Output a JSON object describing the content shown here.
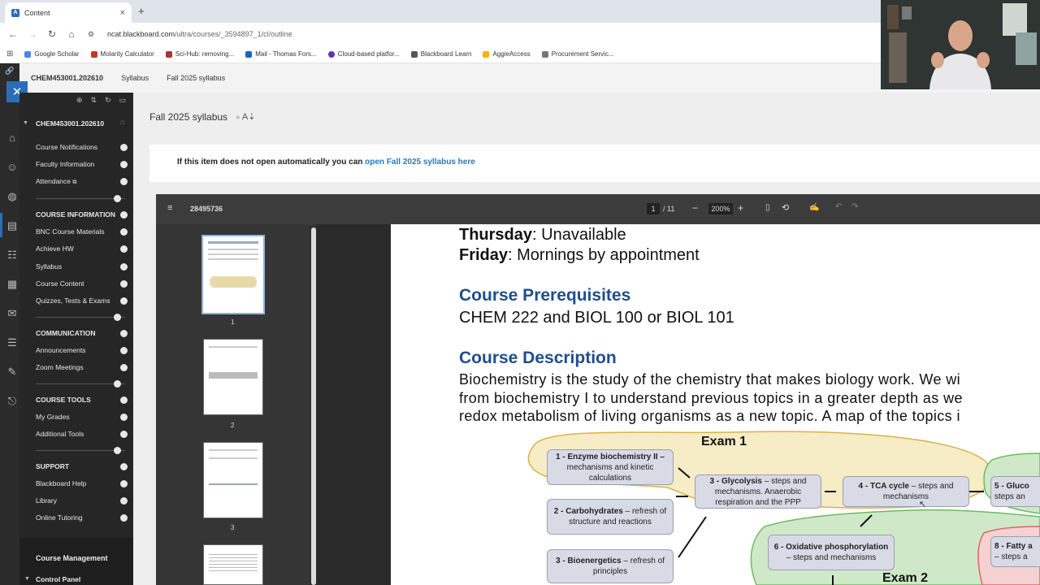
{
  "browser": {
    "tab_title": "Content",
    "tab_close": "×",
    "new_tab": "+",
    "url_host": "ncat.blackboard.com",
    "url_path": "/ultra/courses/_3594897_1/cl/outline",
    "bookmarks": [
      "Google Scholar",
      "Molarity Calculator",
      "Sci-Hub: removing...",
      "Mail - Thomas Fors...",
      "Cloud-based platfor...",
      "Blackboard Learn",
      "AggieAccess",
      "Procurement Servic..."
    ]
  },
  "header": {
    "course_id": "CHEM453001.202610",
    "crumbs": [
      "Syllabus",
      "Fall 2025 syllabus"
    ]
  },
  "menu": {
    "course": "CHEM453001.202610",
    "items": {
      "course_notifications": "Course Notifications",
      "faculty_information": "Faculty Information",
      "attendance": "Attendance",
      "course_information": "COURSE INFORMATION",
      "bnc_course_materials": "BNC Course Materials",
      "achieve_hw": "Achieve HW",
      "syllabus": "Syllabus",
      "course_content": "Course Content",
      "quizzes": "Quizzes, Tests & Exams",
      "communication": "COMMUNICATION",
      "announcements": "Announcements",
      "zoom_meetings": "Zoom Meetings",
      "course_tools": "COURSE TOOLS",
      "my_grades": "My Grades",
      "additional_tools": "Additional Tools",
      "support": "SUPPORT",
      "blackboard_help": "Blackboard Help",
      "library": "Library",
      "online_tutoring": "Online Tutoring",
      "course_management": "Course Management",
      "control_panel": "Control Panel"
    }
  },
  "content": {
    "page_title": "Fall 2025 syllabus",
    "notice_text": "If this item does not open automatically you can ",
    "notice_link": "open Fall 2025 syllabus here"
  },
  "pdf": {
    "doc_id": "28495736",
    "page_current": "1",
    "page_total": "/ 11",
    "zoom": "200%",
    "thumbs": [
      "1",
      "2",
      "3"
    ],
    "lines": {
      "thursday_label": "Thursday",
      "thursday_value": ": Unavailable",
      "friday_label": "Friday",
      "friday_value": ": Mornings by appointment",
      "prereq_heading": "Course Prerequisites",
      "prereq_text": "CHEM 222 and BIOL 100 or BIOL 101",
      "desc_heading": "Course Description",
      "desc_1": "Biochemistry is the study of the chemistry that makes biology work. We wi",
      "desc_2": "from biochemistry I to understand previous topics in a greater depth as we",
      "desc_3": "redox metabolism of living organisms as a new topic. A map of the topics i"
    },
    "map": {
      "exam1": "Exam 1",
      "exam2": "Exam 2",
      "n1_title": "1 - Enzyme biochemistry II –",
      "n1_text": " mechanisms and kinetic calculations",
      "n2_title": "2 - Carbohydrates",
      "n2_text": " – refresh of structure and reactions",
      "n3_title": "3 - Bioenergetics",
      "n3_text": " – refresh of principles",
      "g_title": "3 - Glycolysis",
      "g_text": " – steps and mechanisms. Anaerobic respiration and the PPP",
      "t_title": "4 - TCA cycle",
      "t_text": " – steps and mechanisms",
      "o_title": "6 - Oxidative phosphorylation",
      "o_text": " – steps and mechanisms",
      "glu_title": "5 - Gluco",
      "glu_text": "steps an",
      "fat_title": "8 - Fatty a",
      "fat_text": "– steps a"
    }
  },
  "colors": {
    "accent": "#2a6ebb",
    "link": "#2a7ab5",
    "heading_blue": "#1f4e8c"
  }
}
